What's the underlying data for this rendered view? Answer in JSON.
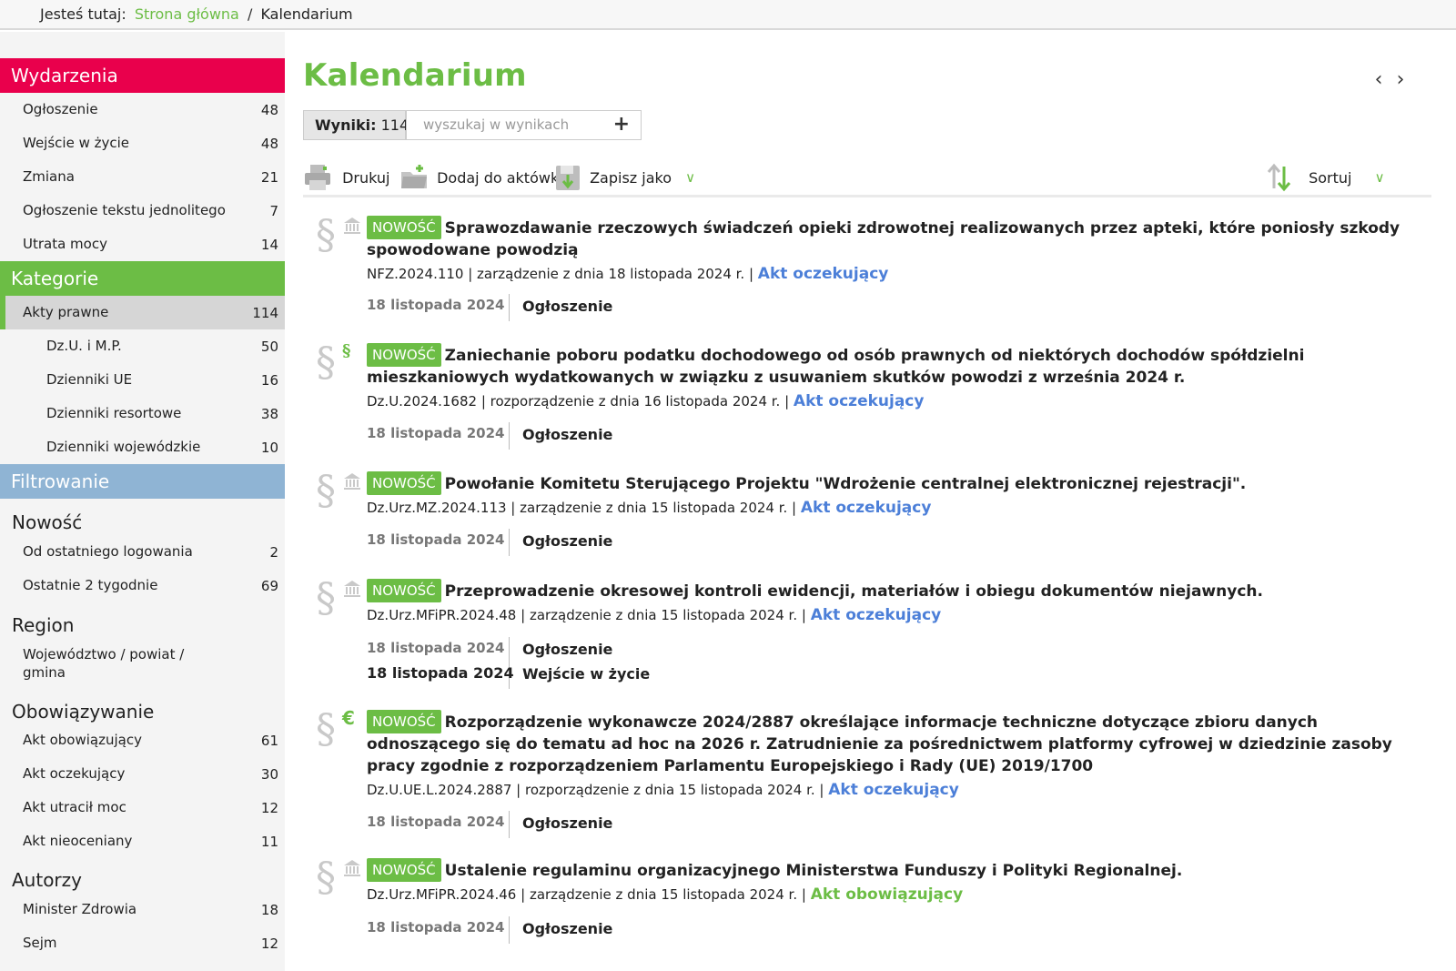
{
  "breadcrumb": {
    "prefix": "Jesteś tutaj:",
    "home": "Strona główna",
    "separator": "/",
    "current": "Kalendarium"
  },
  "sidebar": {
    "events_header": "Wydarzenia",
    "events": [
      {
        "label": "Ogłoszenie",
        "count": "48"
      },
      {
        "label": "Wejście w życie",
        "count": "48"
      },
      {
        "label": "Zmiana",
        "count": "21"
      },
      {
        "label": "Ogłoszenie tekstu jednolitego",
        "count": "7"
      },
      {
        "label": "Utrata mocy",
        "count": "14"
      }
    ],
    "categories_header": "Kategorie",
    "categories": [
      {
        "label": "Akty prawne",
        "count": "114"
      },
      {
        "label": "Dz.U. i M.P.",
        "count": "50"
      },
      {
        "label": "Dzienniki UE",
        "count": "16"
      },
      {
        "label": "Dzienniki resortowe",
        "count": "38"
      },
      {
        "label": "Dzienniki wojewódzkie",
        "count": "10"
      }
    ],
    "filter_header": "Filtrowanie",
    "novelty_header": "Nowość",
    "novelty": [
      {
        "label": "Od ostatniego logowania",
        "count": "2"
      },
      {
        "label": "Ostatnie 2 tygodnie",
        "count": "69"
      }
    ],
    "region_header": "Region",
    "region_line1": "Województwo / powiat /",
    "region_line2": "gmina",
    "validity_header": "Obowiązywanie",
    "validity": [
      {
        "label": "Akt obowiązujący",
        "count": "61"
      },
      {
        "label": "Akt oczekujący",
        "count": "30"
      },
      {
        "label": "Akt utracił moc",
        "count": "12"
      },
      {
        "label": "Akt nieoceniany",
        "count": "11"
      }
    ],
    "authors_header": "Autorzy",
    "authors": [
      {
        "label": "Minister Zdrowia",
        "count": "18"
      },
      {
        "label": "Sejm",
        "count": "12"
      }
    ]
  },
  "main": {
    "title": "Kalendarium",
    "prev": "‹",
    "next": "›",
    "results_label": "Wyniki:",
    "results_count": "114",
    "search_placeholder": "wyszukaj w wynikach",
    "search_plus": "+",
    "print_label": "Drukuj",
    "briefcase_label": "Dodaj do aktówki",
    "save_label": "Zapisz jako",
    "sort_label": "Sortuj"
  },
  "badge": "NOWOŚĆ",
  "items": [
    {
      "title": "Sprawozdawanie rzeczowych świadczeń opieki zdrowotnej realizowanych przez apteki, które poniosły szkody spowodowane powodzią",
      "meta": "NFZ.2024.110 | zarządzenie z dnia 18 listopada 2024 r. | ",
      "status": "Akt oczekujący",
      "icon": "building-icon",
      "dates": [
        {
          "date": "18 listopada 2024",
          "event": "Ogłoszenie"
        }
      ]
    },
    {
      "title": "Zaniechanie poboru podatku dochodowego od osób prawnych od niektórych dochodów spółdzielni mieszkaniowych wydatkowanych w związku z usuwaniem skutków powodzi z września 2024 r.",
      "meta": "Dz.U.2024.1682 | rozporządzenie z dnia 16 listopada 2024 r. | ",
      "status": "Akt oczekujący",
      "icon": "paragraph-icon",
      "dates": [
        {
          "date": "18 listopada 2024",
          "event": "Ogłoszenie"
        }
      ]
    },
    {
      "title": "Powołanie Komitetu Sterującego Projektu \"Wdrożenie centralnej elektronicznej rejestracji\".",
      "meta": "Dz.Urz.MZ.2024.113 | zarządzenie z dnia 15 listopada 2024 r. | ",
      "status": "Akt oczekujący",
      "icon": "building-icon",
      "dates": [
        {
          "date": "18 listopada 2024",
          "event": "Ogłoszenie"
        }
      ]
    },
    {
      "title": "Przeprowadzenie okresowej kontroli ewidencji, materiałów i obiegu dokumentów niejawnych.",
      "meta": "Dz.Urz.MFiPR.2024.48 | zarządzenie z dnia 15 listopada 2024 r. | ",
      "status": "Akt oczekujący",
      "icon": "building-icon",
      "dates": [
        {
          "date": "18 listopada 2024",
          "event": "Ogłoszenie"
        },
        {
          "date": "18 listopada 2024",
          "event": "Wejście w życie"
        }
      ]
    },
    {
      "title": "Rozporządzenie wykonawcze 2024/2887 określające informacje techniczne dotyczące zbioru danych odnoszącego się do tematu ad hoc na 2026 r. Zatrudnienie za pośrednictwem platformy cyfrowej w dziedzinie zasoby pracy zgodnie z rozporządzeniem Parlamentu Europejskiego i Rady (UE) 2019/1700",
      "meta": "Dz.U.UE.L.2024.2887 | rozporządzenie z dnia 15 listopada 2024 r. | ",
      "status": "Akt oczekujący",
      "icon": "euro-icon",
      "dates": [
        {
          "date": "18 listopada 2024",
          "event": "Ogłoszenie"
        }
      ]
    },
    {
      "title": "Ustalenie regulaminu organizacyjnego Ministerstwa Funduszy i Polityki Regionalnej.",
      "meta": "Dz.Urz.MFiPR.2024.46 | zarządzenie z dnia 15 listopada 2024 r. | ",
      "status": "Akt obowiązujący",
      "icon": "building-icon",
      "dates": [
        {
          "date": "18 listopada 2024",
          "event": "Ogłoszenie"
        }
      ]
    }
  ],
  "colors": {
    "accent_green": "#6cbd45",
    "events_red": "#e9004c",
    "filter_blue": "#8fb4d4",
    "link_blue": "#4c7fd8"
  }
}
